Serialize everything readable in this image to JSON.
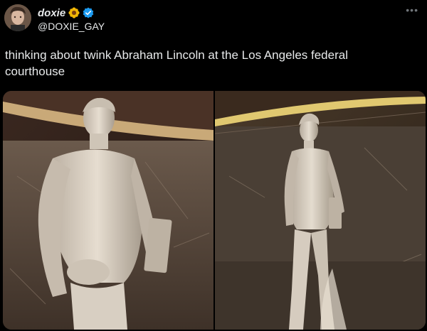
{
  "author": {
    "display_name": "doxie",
    "handle": "@DOXIE_GAY",
    "badge_icon": "flower-icon",
    "verified_icon": "verified-badge-icon"
  },
  "tweet": {
    "text": "thinking about twink Abraham Lincoln at the Los Angeles federal courthouse"
  },
  "menu": {
    "more_icon": "more-options-icon"
  },
  "colors": {
    "background": "#000000",
    "text": "#e7e9ea",
    "secondary": "#71767b",
    "verified": "#1d9bf0"
  }
}
